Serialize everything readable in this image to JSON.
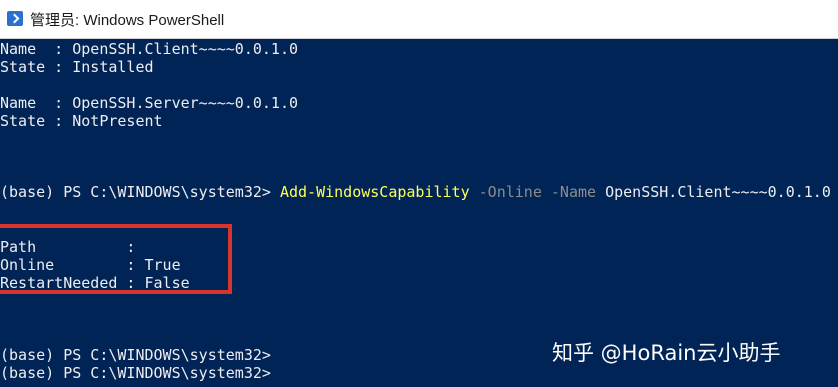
{
  "window": {
    "title": "管理员: Windows PowerShell",
    "icon": "powershell-icon",
    "background": "#012456"
  },
  "console": {
    "lines": [
      "Name  : OpenSSH.Client~~~~0.0.1.0",
      "State : Installed",
      "Name  : OpenSSH.Server~~~~0.0.1.0",
      "State : NotPresent",
      "Path          :",
      "Online        : True",
      "RestartNeeded : False",
      "(base) PS C:\\WINDOWS\\system32>",
      "(base) PS C:\\WINDOWS\\system32>"
    ],
    "command": {
      "prompt": "(base) PS C:\\WINDOWS\\system32> ",
      "cmdlet": "Add-WindowsCapability",
      "param_online": " -Online",
      "param_name": " -Name",
      "argument": " OpenSSH.Client~~~~0.0.1.0"
    }
  },
  "watermark": "知乎 @HoRain云小助手",
  "colors": {
    "cmdlet": "#ffff55",
    "parameter": "#8c8c8c",
    "text": "#eeedf0",
    "highlight": "#d9342b"
  }
}
